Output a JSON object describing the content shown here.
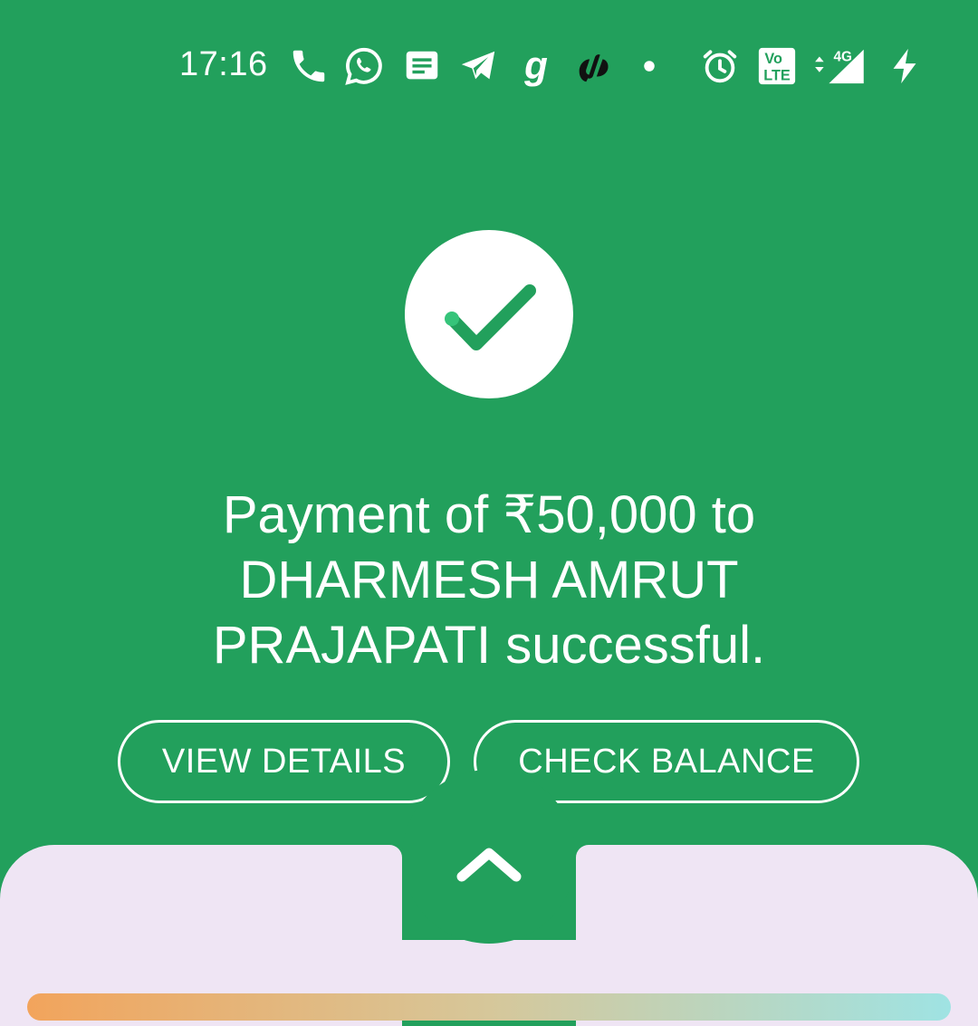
{
  "status_bar": {
    "time": "17:16",
    "icons": [
      "phone-icon",
      "whatsapp-icon",
      "message-icon",
      "telegram-icon",
      "g-app-icon",
      "app-icon",
      "dot-icon",
      "alarm-icon",
      "volte-icon",
      "signal-4g-icon",
      "charging-icon"
    ],
    "volte_label_top": "Vo",
    "volte_label_bottom": "LTE",
    "network_label": "4G"
  },
  "success": {
    "message": "Payment of ₹50,000 to DHARMESH AMRUT PRAJAPATI successful."
  },
  "actions": {
    "view_details": "VIEW DETAILS",
    "check_balance": "CHECK BALANCE"
  },
  "colors": {
    "primary_green": "#22a05c",
    "sheet_background": "#efe5f4",
    "white": "#ffffff"
  }
}
